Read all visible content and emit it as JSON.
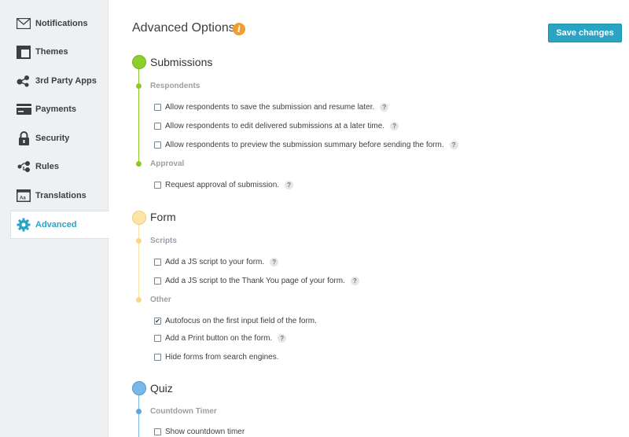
{
  "sidebar": {
    "items": [
      {
        "label": "Notifications",
        "icon": "envelope-icon"
      },
      {
        "label": "Themes",
        "icon": "themes-icon"
      },
      {
        "label": "3rd Party Apps",
        "icon": "apps-icon"
      },
      {
        "label": "Payments",
        "icon": "credit-card-icon"
      },
      {
        "label": "Security",
        "icon": "lock-icon"
      },
      {
        "label": "Rules",
        "icon": "rules-icon"
      },
      {
        "label": "Translations",
        "icon": "translation-icon"
      },
      {
        "label": "Advanced",
        "icon": "gear-icon"
      }
    ],
    "active": "Advanced"
  },
  "header": {
    "title": "Advanced Options",
    "info_glyph": "i",
    "save_label": "Save changes"
  },
  "sections": {
    "submissions": {
      "title": "Submissions",
      "color": "#8ccf2a",
      "respondents": {
        "title": "Respondents",
        "options": [
          {
            "label": "Allow respondents to save the submission and resume later.",
            "checked": false
          },
          {
            "label": "Allow respondents to edit delivered submissions at a later time.",
            "checked": false
          },
          {
            "label": "Allow respondents to preview the submission summary before sending the form.",
            "checked": false
          }
        ]
      },
      "approval": {
        "title": "Approval",
        "options": [
          {
            "label": "Request approval of submission.",
            "checked": false
          }
        ]
      }
    },
    "form": {
      "title": "Form",
      "color": "#fde5a8",
      "scripts": {
        "title": "Scripts",
        "options": [
          {
            "label": "Add a JS script to your form.",
            "checked": false
          },
          {
            "label": "Add a JS script to the Thank You page of your form.",
            "checked": false
          }
        ]
      },
      "other": {
        "title": "Other",
        "options": [
          {
            "label": "Autofocus on the first input field of the form.",
            "checked": true
          },
          {
            "label": "Add a Print button on the form.",
            "checked": false
          },
          {
            "label": "Hide forms from search engines.",
            "checked": false
          }
        ]
      }
    },
    "quiz": {
      "title": "Quiz",
      "color": "#7ab8e8",
      "countdown": {
        "title": "Countdown Timer",
        "options": [
          {
            "label": "Show countdown timer",
            "checked": false
          }
        ]
      }
    }
  },
  "help_glyph": "?",
  "check_glyph": "✔",
  "accent_color": "#2aa3c4"
}
